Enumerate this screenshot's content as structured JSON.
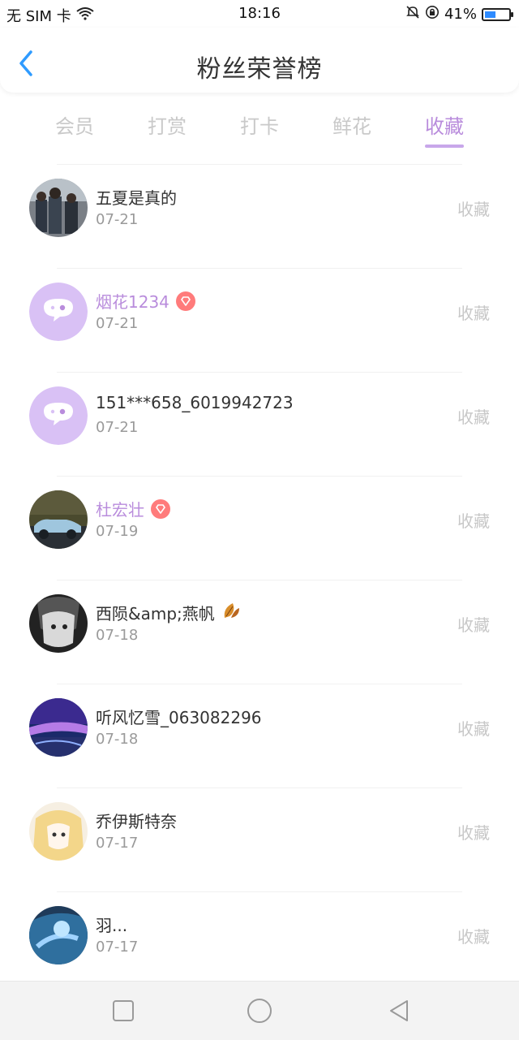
{
  "status_bar": {
    "carrier": "无 SIM 卡",
    "time": "18:16",
    "battery_text": "41%"
  },
  "header": {
    "title": "粉丝荣誉榜"
  },
  "tabs": [
    {
      "label": "会员",
      "active": false
    },
    {
      "label": "打赏",
      "active": false
    },
    {
      "label": "打卡",
      "active": false
    },
    {
      "label": "鲜花",
      "active": false
    },
    {
      "label": "收藏",
      "active": true
    }
  ],
  "rows": [
    {
      "name": "五夏是真的",
      "date": "07-21",
      "action": "收藏"
    },
    {
      "name": "烟花1234",
      "date": "07-21",
      "action": "收藏",
      "badge": "diamond-badge-icon",
      "highlight": true
    },
    {
      "name": "151***658_6019942723",
      "date": "07-21",
      "action": "收藏"
    },
    {
      "name": "杜宏壮",
      "date": "07-19",
      "action": "收藏",
      "badge": "diamond-badge-icon",
      "highlight": true
    },
    {
      "name": "西陨&amp;燕帆",
      "date": "07-18",
      "action": "收藏",
      "badge": "leaf-emoji-icon"
    },
    {
      "name": "听风忆雪_063082296",
      "date": "07-18",
      "action": "收藏"
    },
    {
      "name": "乔伊斯特奈",
      "date": "07-17",
      "action": "收藏"
    },
    {
      "name": "羽...",
      "date": "07-17",
      "action": "收藏"
    }
  ],
  "colors": {
    "accent": "#b98cdc",
    "tab_inactive": "#c9c9c9",
    "badge_red": "#ff7b7b",
    "date_gray": "#9a9a9a",
    "action_gray": "#c7c7c7"
  },
  "icons": {
    "back": "back-chevron-icon",
    "wifi": "wifi-icon",
    "mute": "bell-muted-icon",
    "lock": "rotation-lock-icon",
    "battery": "battery-icon",
    "nav_recent": "square-icon",
    "nav_home": "circle-icon",
    "nav_back": "triangle-back-icon"
  }
}
